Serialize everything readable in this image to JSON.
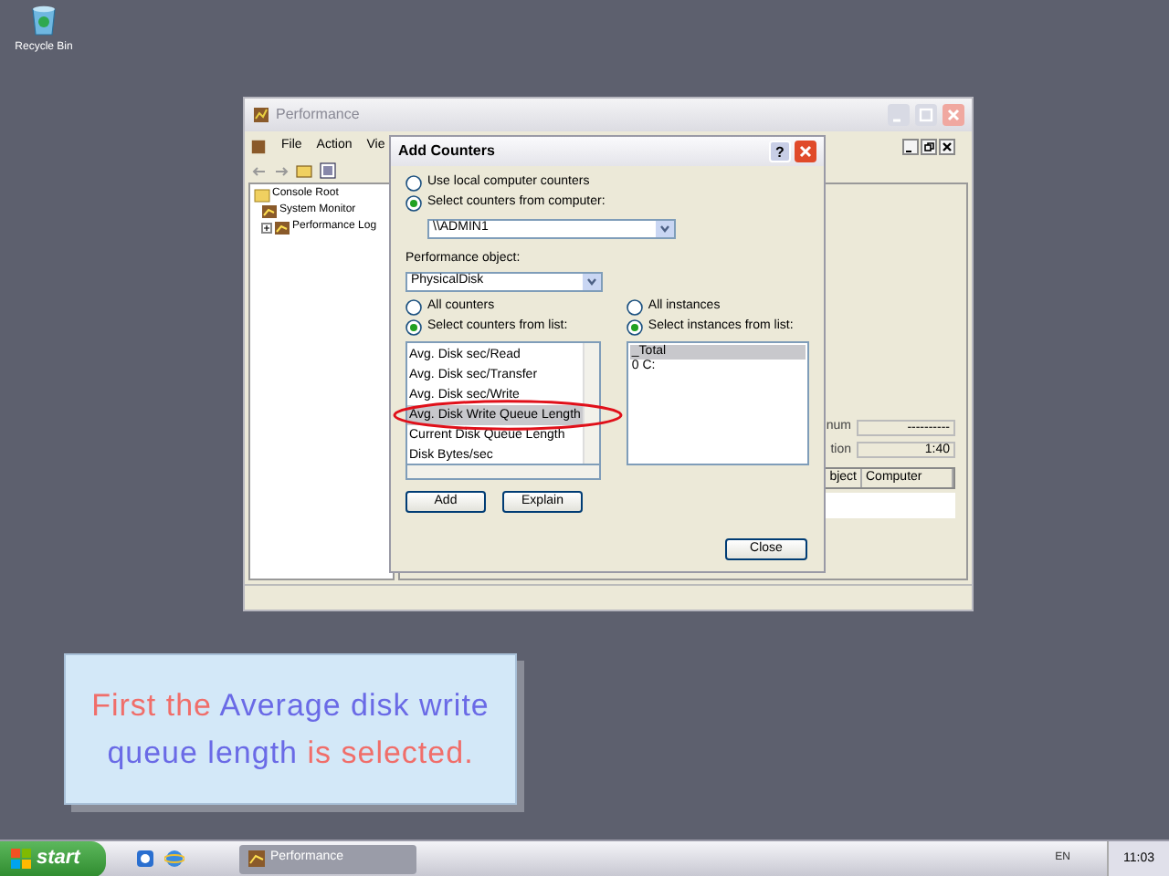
{
  "desktop_icons": [
    {
      "label": "Recycle Bin"
    }
  ],
  "performance_window": {
    "title": "Performance",
    "menu": [
      "File",
      "Action",
      "Vie"
    ],
    "tree": [
      {
        "label": "Console Root",
        "children": [
          {
            "label": "System Monitor"
          },
          {
            "label": "Performance Log"
          }
        ]
      }
    ],
    "values": [
      {
        "label": "num",
        "value": "----------"
      },
      {
        "label": "tion",
        "value": "1:40"
      }
    ],
    "columns": [
      "bject",
      "Computer"
    ]
  },
  "dialog": {
    "title": "Add Counters",
    "help": "?",
    "computer_source": [
      {
        "label": "Use local computer counters",
        "selected": false
      },
      {
        "label": "Select counters from computer:",
        "selected": true
      }
    ],
    "computer": "\\\\ADMIN1",
    "object_label": "Performance object:",
    "object": "PhysicalDisk",
    "counter_mode": [
      {
        "label": "All counters",
        "selected": false
      },
      {
        "label": "Select counters from list:",
        "selected": true
      }
    ],
    "instance_mode": [
      {
        "label": "All instances",
        "selected": false
      },
      {
        "label": "Select instances from list:",
        "selected": true
      }
    ],
    "counters": [
      {
        "label": "Avg. Disk sec/Read",
        "selected": false
      },
      {
        "label": "Avg. Disk sec/Transfer",
        "selected": false
      },
      {
        "label": "Avg. Disk sec/Write",
        "selected": false
      },
      {
        "label": "Avg. Disk Write Queue Length",
        "selected": true
      },
      {
        "label": "Current Disk Queue Length",
        "selected": false
      },
      {
        "label": "Disk Bytes/sec",
        "selected": false
      }
    ],
    "instances": [
      {
        "label": "_Total",
        "selected": true
      },
      {
        "label": "0 C:",
        "selected": false
      }
    ],
    "buttons": [
      "Add",
      "Explain"
    ],
    "close": "Close"
  },
  "caption": {
    "segments": [
      {
        "text": "First the",
        "color": "#f06e6a"
      },
      {
        "text": "Average disk write queue length",
        "color": "#6a6ae6"
      },
      {
        "text": "is selected.",
        "color": "#f06e6a"
      }
    ]
  },
  "taskbar": {
    "start": "start",
    "tasks": [
      {
        "label": "Performance",
        "selected": true
      }
    ],
    "language": "EN",
    "clock": "11:03"
  }
}
